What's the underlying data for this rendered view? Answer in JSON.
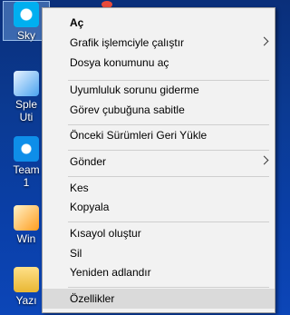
{
  "desktop": {
    "icons": [
      {
        "label": "Sky",
        "glyph": "skype-icon"
      },
      {
        "label": "Sple",
        "label2": "Uti",
        "glyph": "splendid-icon"
      },
      {
        "label": "Team",
        "label2": "1",
        "glyph": "teamviewer-icon"
      },
      {
        "label": "Win",
        "glyph": "windows-app-icon"
      },
      {
        "label": "Yazı",
        "glyph": "folder-icon"
      }
    ]
  },
  "context_menu": {
    "items": {
      "open": "Aç",
      "run_with_gpu": "Grafik işlemciyle çalıştır",
      "open_location": "Dosya konumunu aç",
      "troubleshoot": "Uyumluluk sorunu giderme",
      "pin_taskbar": "Görev çubuğuna sabitle",
      "restore_versions": "Önceki Sürümleri Geri Yükle",
      "send_to": "Gönder",
      "cut": "Kes",
      "copy": "Kopyala",
      "create_shortcut": "Kısayol oluştur",
      "delete": "Sil",
      "rename": "Yeniden adlandır",
      "properties": "Özellikler"
    }
  },
  "colors": {
    "menu_background": "#f2f2f2",
    "menu_highlight": "#dadada",
    "desktop_background": "#0b3a92"
  }
}
